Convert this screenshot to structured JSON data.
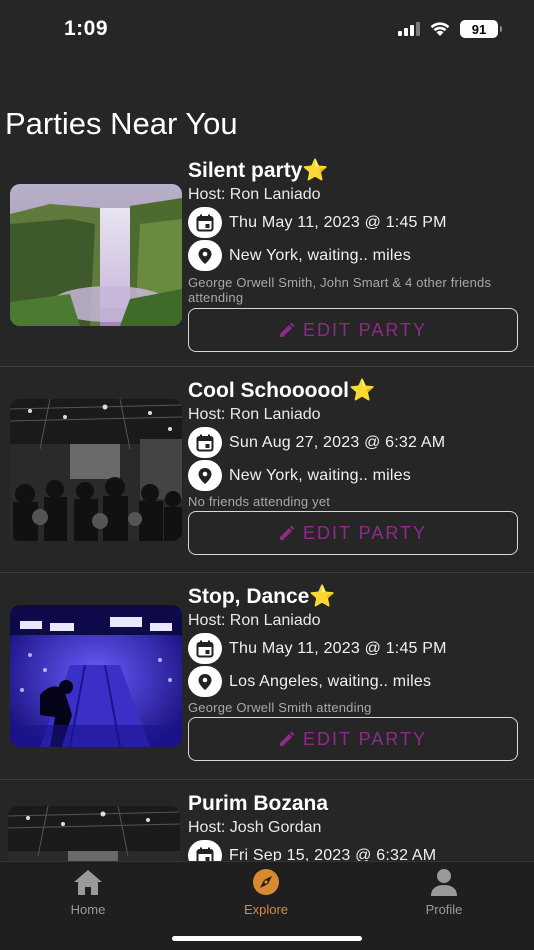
{
  "status": {
    "time": "1:09",
    "battery": "91"
  },
  "page": {
    "title": "Parties Near You"
  },
  "parties": [
    {
      "name": "Silent party",
      "star": "⭐",
      "host": "Host: Ron Laniado",
      "date": "Thu May 11, 2023 @ 1:45 PM",
      "location": "New York, waiting.. miles",
      "friends": "George Orwell Smith, John Smart & 4 other friends attending",
      "button": "EDIT PARTY",
      "image": "waterfall"
    },
    {
      "name": "Cool Schoooool",
      "star": "⭐",
      "host": "Host: Ron Laniado",
      "date": "Sun Aug 27, 2023 @ 6:32 AM",
      "location": "New York, waiting.. miles",
      "friends": "No friends attending yet",
      "button": "EDIT PARTY",
      "image": "crowd"
    },
    {
      "name": "Stop, Dance",
      "star": "⭐",
      "host": "Host: Ron Laniado",
      "date": "Thu May 11, 2023 @ 1:45 PM",
      "location": "Los Angeles, waiting.. miles",
      "friends": "George Orwell Smith attending",
      "button": "EDIT PARTY",
      "image": "bowling"
    },
    {
      "name": "Purim Bozana",
      "star": "",
      "host": "Host: Josh Gordan",
      "date": "Fri Sep 15, 2023 @ 6:32 AM",
      "location": "",
      "friends": "",
      "button": "",
      "image": "crowd"
    }
  ],
  "tabs": [
    {
      "label": "Home",
      "icon": "home-icon"
    },
    {
      "label": "Explore",
      "icon": "compass-icon",
      "active": true
    },
    {
      "label": "Profile",
      "icon": "person-icon"
    }
  ],
  "colors": {
    "background": "#262626",
    "accent": "#d88a33",
    "button_text": "#8e2a8a"
  }
}
